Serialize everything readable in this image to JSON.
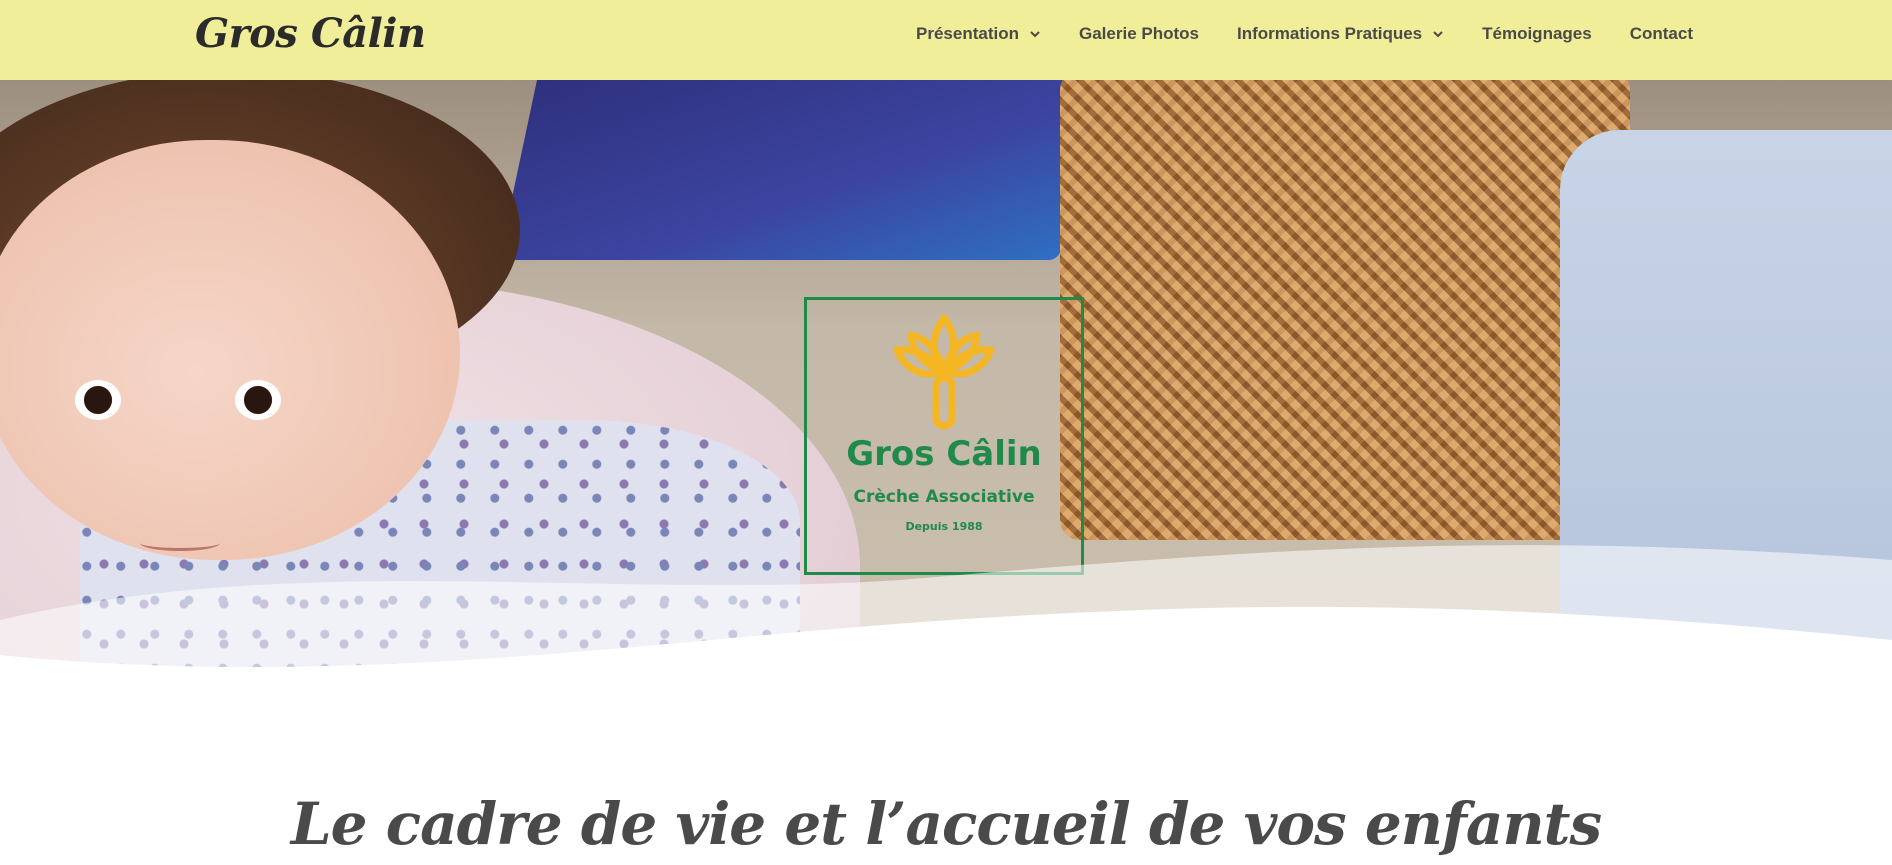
{
  "header": {
    "brand": "Gros Câlin",
    "background": "#f0ee98",
    "nav": [
      {
        "label": "Présentation",
        "has_dropdown": true
      },
      {
        "label": "Galerie Photos",
        "has_dropdown": false
      },
      {
        "label": "Informations Pratiques",
        "has_dropdown": true
      },
      {
        "label": "Témoignages",
        "has_dropdown": false
      },
      {
        "label": "Contact",
        "has_dropdown": false
      }
    ]
  },
  "hero": {
    "logo": {
      "title": "Gros Câlin",
      "subtitle": "Crèche Associative",
      "since": "Depuis 1988",
      "icon": "lotus-flower-icon",
      "green": "#1f8a4a",
      "yellow": "#f5b623"
    }
  },
  "main": {
    "heading": "Le cadre de vie et l’accueil de vos enfants"
  }
}
